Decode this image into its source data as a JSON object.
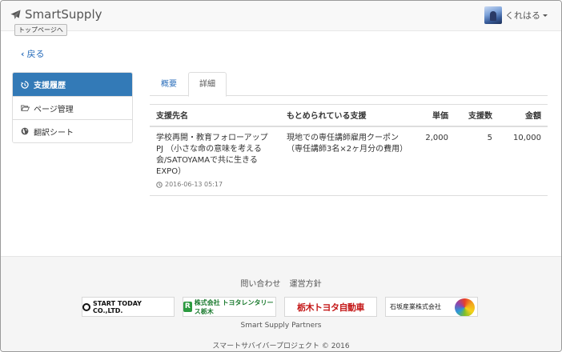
{
  "header": {
    "brand": "SmartSupply",
    "top_page_button": "トップページへ",
    "user_name": "くれはる"
  },
  "back_link": "戻る",
  "sidebar": {
    "items": [
      {
        "label": "支援履歴",
        "icon": "history-icon",
        "active": true
      },
      {
        "label": "ページ管理",
        "icon": "folder-open-icon",
        "active": false
      },
      {
        "label": "翻訳シート",
        "icon": "globe-icon",
        "active": false
      }
    ]
  },
  "tabs": [
    {
      "label": "概要",
      "active": false
    },
    {
      "label": "詳細",
      "active": true
    }
  ],
  "table": {
    "columns": [
      "支援先名",
      "もとめられている支援",
      "単価",
      "支援数",
      "金額"
    ],
    "rows": [
      {
        "recipient": "学校再開・教育フォローアップPJ （小さな命の意味を考える会/SATOYAMAで共に生きるEXPO）",
        "timestamp": "2016-06-13 05:17",
        "support": "現地での専任講師雇用クーポン（専任講師3名×2ヶ月分の費用）",
        "unit_price": "2,000",
        "count": "5",
        "amount": "10,000"
      }
    ]
  },
  "footer": {
    "links": [
      "問い合わせ",
      "運営方針"
    ],
    "partners": [
      {
        "name": "START TODAY CO.,LTD."
      },
      {
        "name": "株式会社 トヨタレンタリース栃木",
        "mark": "R"
      },
      {
        "name": "栃木トヨタ自動車"
      },
      {
        "name": "石坂産業株式会社"
      }
    ],
    "partners_label": "Smart Supply Partners",
    "copyright": "スマートサバイバープロジェクト © 2016"
  },
  "colors": {
    "accent": "#337ab7",
    "link": "#2a6ebb"
  }
}
